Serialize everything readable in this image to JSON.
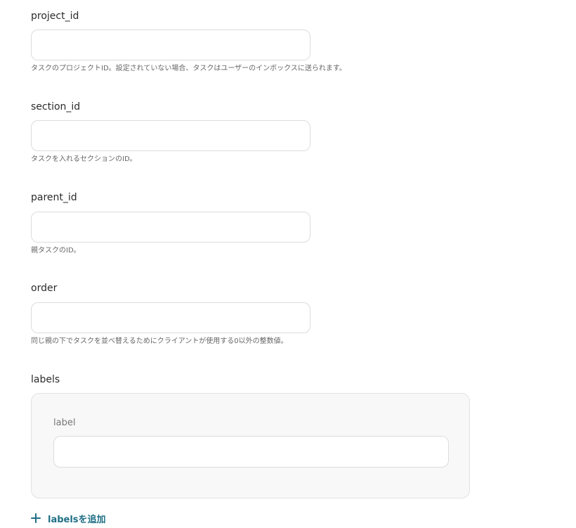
{
  "fields": [
    {
      "name": "project_id",
      "value": "",
      "placeholder": "",
      "help": "タスクのプロジェクトID。設定されていない場合、タスクはユーザーのインボックスに送られます。"
    },
    {
      "name": "section_id",
      "value": "",
      "placeholder": "",
      "help": "タスクを入れるセクションのID。"
    },
    {
      "name": "parent_id",
      "value": "",
      "placeholder": "",
      "help": "親タスクのID。"
    },
    {
      "name": "order",
      "value": "",
      "placeholder": "",
      "help": "同じ親の下でタスクを並べ替えるためにクライアントが使用する0以外の整数値。"
    }
  ],
  "labels_section": {
    "title": "labels",
    "item_label": "label",
    "item_value": "",
    "add_button_label": "labelsを追加",
    "add_icon": "plus-icon",
    "accent_color": "#1f6f86"
  }
}
